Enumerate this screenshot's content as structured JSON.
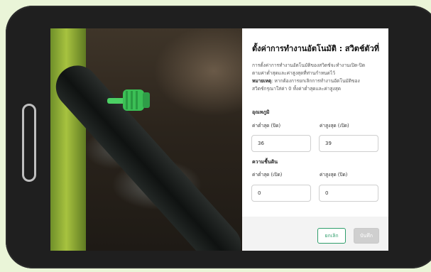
{
  "dialog": {
    "title": "ตั้งค่าการทำงานอัตโนมัติ : สวิตช์ตัวที่",
    "description_line1": "การตั้งค่าการทำงานอัตโนมัติของสวิตช์จะทำงานเปิด-ปิด",
    "description_line2": "ตามค่าต่ำสุดและค่าสูงสุดที่ท่านกำหนดไว้",
    "note_label": "หมายเหตุ",
    "note_text": ": หากต้องการยกเลิกการทำงานอัตโนมัติของ",
    "note_text2": "สวิตช์กรุณาใส่ค่า 0 ทั้งค่าต่ำสุดและค่าสูงสุด"
  },
  "temperature": {
    "section_label": "อุณหภูมิ",
    "min_label": "ค่าต่ำสุด (ปิด)",
    "max_label": "ค่าสูงสุด (เปิด)",
    "min_value": "36",
    "max_value": "39"
  },
  "soil_moisture": {
    "section_label": "ความชื้นดิน",
    "min_label": "ค่าต่ำสุด (เปิด)",
    "max_label": "ค่าสูงสุด (ปิด)",
    "min_value": "0",
    "max_value": "0"
  },
  "footer": {
    "cancel_label": "ยกเลิก",
    "save_label": "บันทึก"
  },
  "colors": {
    "accent": "#2f9e6b",
    "disabled": "#cfcfcf"
  }
}
